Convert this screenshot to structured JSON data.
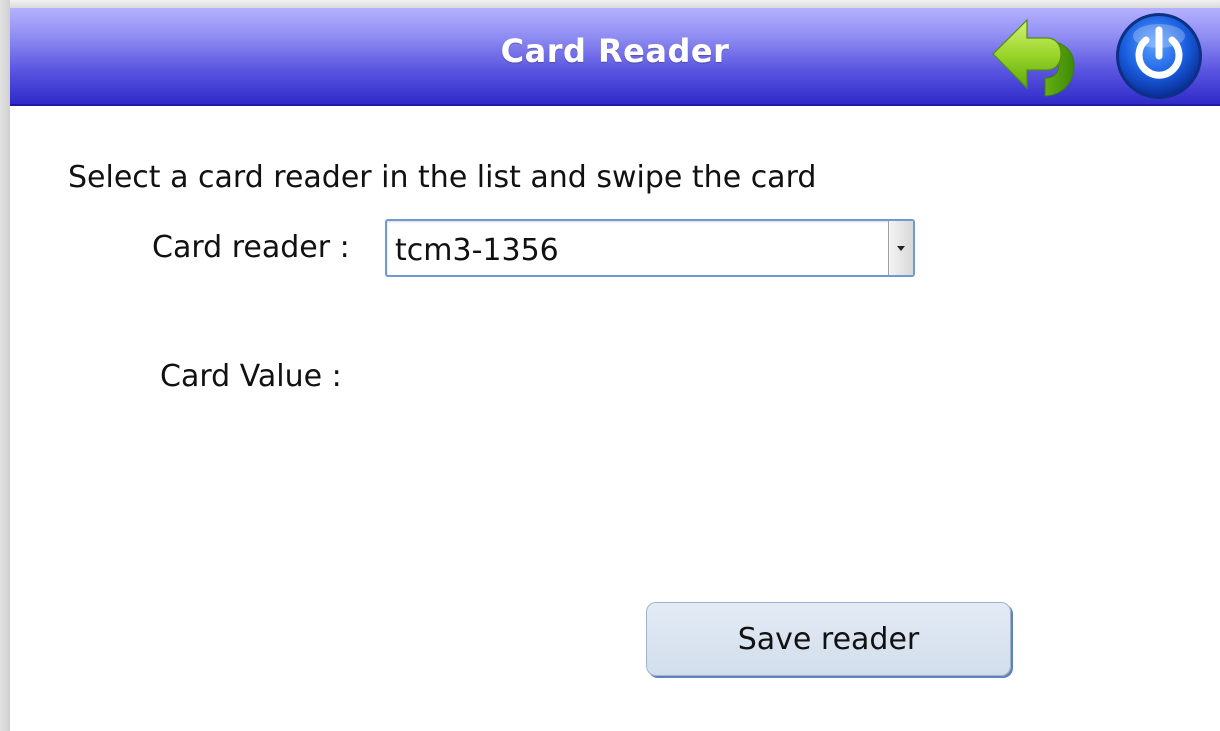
{
  "header": {
    "title": "Card Reader",
    "back_icon": "back-arrow-icon",
    "power_icon": "power-icon",
    "bar_color": "#4d48d8"
  },
  "main": {
    "instruction": "Select a card reader in the list and swipe the card",
    "reader_label": "Card reader :",
    "reader_selected": "tcm3-1356",
    "value_label": "Card Value :",
    "card_value": "",
    "save_label": "Save reader"
  },
  "colors": {
    "accent_blue": "#1d5fe0",
    "arrow_green": "#8cd21e"
  }
}
